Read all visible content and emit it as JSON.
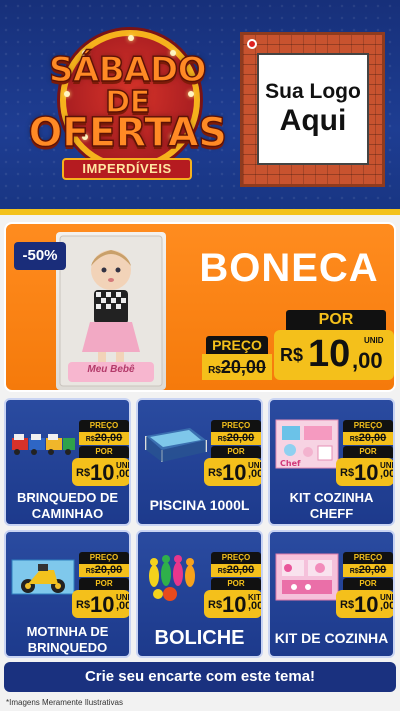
{
  "header": {
    "badge": {
      "line1": "SÁBADO",
      "line2": "DE",
      "line3": "OFERTAS",
      "subtitle": "IMPERDÍVEIS"
    },
    "logo": {
      "line1": "Sua Logo",
      "line2": "Aqui"
    }
  },
  "featured": {
    "discount": "-50%",
    "title": "BONECA",
    "box_text": "Meu Bebê",
    "price_label": "PREÇO",
    "old_price": "20,00",
    "old_prefix": "R$",
    "por_label": "POR",
    "currency": "R$",
    "price_int": "10",
    "price_cents": ",00",
    "unit": "UNID"
  },
  "cards": [
    {
      "name": "BRINQUEDO DE CAMINHAO",
      "price_label": "PREÇO",
      "old_price": "20,00",
      "old_prefix": "R$",
      "por_label": "POR",
      "currency": "R$",
      "price_int": "10",
      "price_cents": ",00",
      "unit": "UNID",
      "icon": "truck-toy-icon"
    },
    {
      "name": "PISCINA 1000L",
      "price_label": "PREÇO",
      "old_price": "20,00",
      "old_prefix": "R$",
      "por_label": "POR",
      "currency": "R$",
      "price_int": "10",
      "price_cents": ",00",
      "unit": "UNID",
      "icon": "pool-icon"
    },
    {
      "name": "KIT COZINHA CHEFF",
      "price_label": "PREÇO",
      "old_price": "20,00",
      "old_prefix": "R$",
      "por_label": "POR",
      "currency": "R$",
      "price_int": "10",
      "price_cents": ",00",
      "unit": "UNID",
      "icon": "kitchen-toy-icon"
    },
    {
      "name": "MOTINHA DE BRINQUEDO",
      "price_label": "PREÇO",
      "old_price": "20,00",
      "old_prefix": "R$",
      "por_label": "POR",
      "currency": "R$",
      "price_int": "10",
      "price_cents": ",00",
      "unit": "UNID",
      "icon": "toy-motorbike-icon"
    },
    {
      "name": "BOLICHE",
      "price_label": "PREÇO",
      "old_price": "20,00",
      "old_prefix": "R$",
      "por_label": "POR",
      "currency": "R$",
      "price_int": "10",
      "price_cents": ",00",
      "unit": "KIT",
      "icon": "bowling-icon"
    },
    {
      "name": "KIT DE COZINHA",
      "price_label": "PREÇO",
      "old_price": "20,00",
      "old_prefix": "R$",
      "por_label": "POR",
      "currency": "R$",
      "price_int": "10",
      "price_cents": ",00",
      "unit": "UNID",
      "icon": "pink-kitchen-icon"
    }
  ],
  "footer": {
    "cta": "Crie seu encarte com este tema!",
    "disclaimer": "*Imagens Meramente Ilustrativas"
  },
  "colors": {
    "navy": "#1e3d92",
    "orange": "#f57a0b",
    "yellow": "#f4c01b",
    "red": "#b51b20"
  }
}
